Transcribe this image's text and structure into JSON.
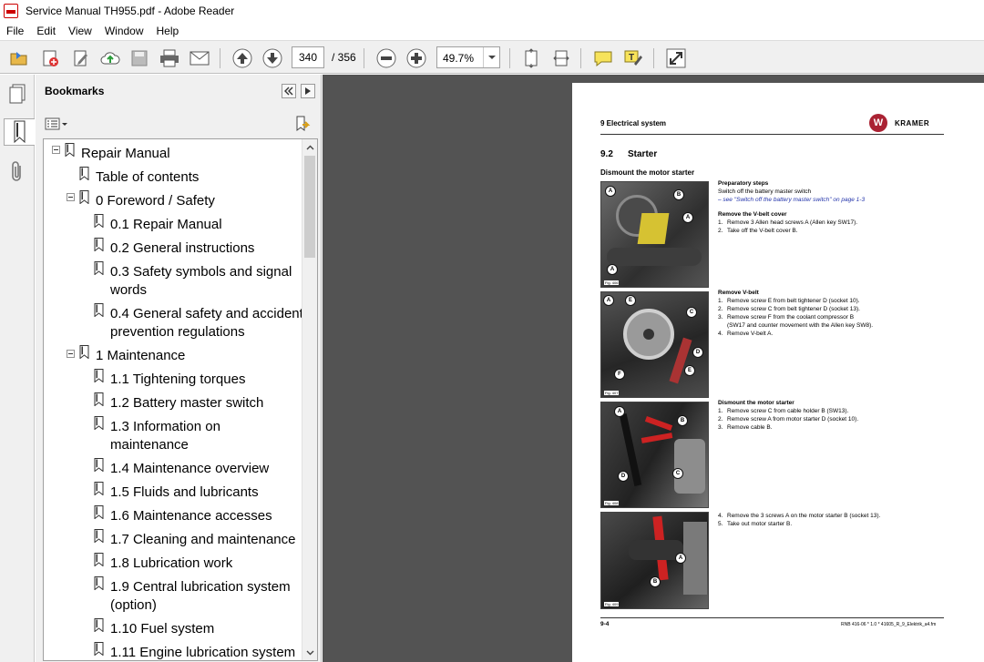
{
  "window": {
    "title": "Service Manual TH955.pdf - Adobe Reader"
  },
  "menu": [
    "File",
    "Edit",
    "View",
    "Window",
    "Help"
  ],
  "toolbar": {
    "page_current": "340",
    "page_total": "/ 356",
    "zoom": "49.7%"
  },
  "bookmarks": {
    "title": "Bookmarks",
    "items": [
      {
        "label": "Repair Manual"
      },
      {
        "label": "Table of contents"
      },
      {
        "label": "0 Foreword / Safety"
      },
      {
        "label": "0.1 Repair Manual"
      },
      {
        "label": "0.2 General instructions"
      },
      {
        "label": "0.3 Safety symbols and signal words"
      },
      {
        "label": "0.4 General safety and accident prevention regulations"
      },
      {
        "label": "1 Maintenance"
      },
      {
        "label": "1.1 Tightening torques"
      },
      {
        "label": "1.2 Battery master switch"
      },
      {
        "label": "1.3 Information on maintenance"
      },
      {
        "label": "1.4 Maintenance overview"
      },
      {
        "label": "1.5 Fluids and lubricants"
      },
      {
        "label": "1.6 Maintenance accesses"
      },
      {
        "label": "1.7 Cleaning and maintenance"
      },
      {
        "label": "1.8 Lubrication work"
      },
      {
        "label": "1.9 Central lubrication system (option)"
      },
      {
        "label": "1.10 Fuel system"
      },
      {
        "label": "1.11 Engine lubrication system"
      }
    ]
  },
  "page": {
    "section": "9  Electrical system",
    "logo": "KRAMER",
    "number": "9.2",
    "heading": "Starter",
    "subheading": "Dismount the motor starter",
    "prep_title": "Preparatory steps",
    "prep_line": "Switch off the battery master switch",
    "prep_link": "– see \"Switch off the battery master switch\" on page 1-3",
    "vbelt_cover_title": "Remove the V-belt cover",
    "vbelt_cover_steps": [
      "1.",
      "Remove 3 Allen head screws A (Allen key SW17).",
      "2.",
      "Take off the V-belt cover B."
    ],
    "vbelt_title": "Remove V-belt",
    "vbelt_steps": [
      "1.",
      "Remove screw E from belt tightener D (socket 10).",
      "2.",
      "Remove screw C from belt tightener D (socket 13).",
      "3.",
      "Remove screw F from the coolant compressor B",
      "(SW17 and counter movement with the Allen key SW8).",
      "4.",
      "Remove V-belt A."
    ],
    "starter_title": "Dismount the motor starter",
    "starter_steps": [
      "1.",
      "Remove screw C from cable holder B (SW13).",
      "2.",
      "Remove screw A from motor starter D (socket 10).",
      "3.",
      "Remove cable B."
    ],
    "final_steps": [
      "4.",
      "Remove the 3 screws A on the motor starter B (socket 13).",
      "5.",
      "Take out motor starter B."
    ],
    "figures": [
      "Fig. 406",
      "Fig. 407",
      "Fig. 408",
      "Fig. 409"
    ],
    "callouts": {
      "f406": [
        "A",
        "B",
        "A",
        "A"
      ],
      "f407": [
        "A",
        "E",
        "C",
        "D",
        "E",
        "F"
      ],
      "f408": [
        "A",
        "B",
        "D",
        "C"
      ],
      "f409": [
        "A",
        "B"
      ]
    },
    "footer_left": "9-4",
    "footer_right": "RNB 416-06 * 1.0 * 41605_R_9_Elektrik_a4.fm"
  }
}
